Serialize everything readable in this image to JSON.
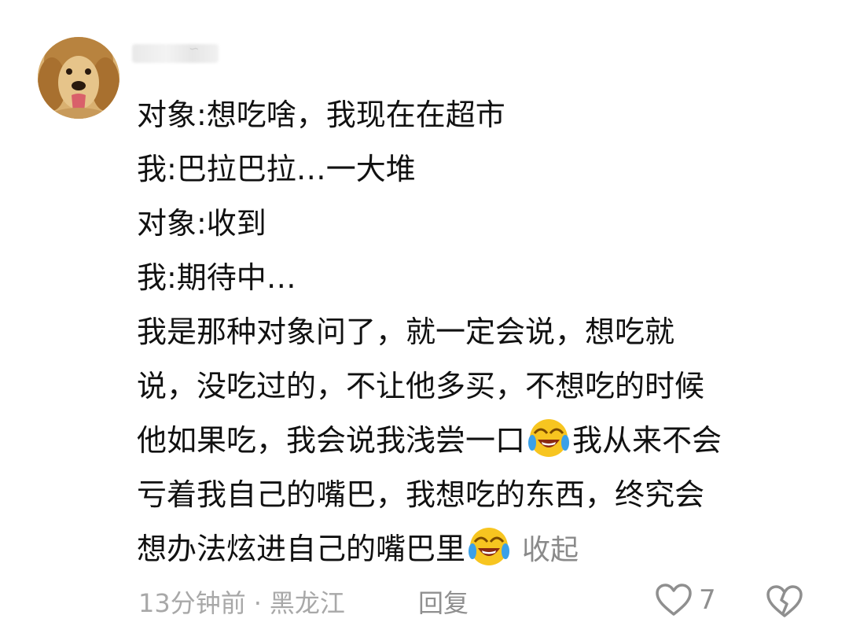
{
  "comment": {
    "author_avatar": "golden-retriever-avatar",
    "lines": [
      "对象:想吃啥，我现在在超市",
      "我:巴拉巴拉…一大堆",
      "对象:收到",
      "我:期待中…",
      "我是那种对象问了，就一定会说，想吃就",
      "说，没吃过的，不让他多买，不想吃的时候",
      "他如果吃，我会说我浅尝一口",
      "我从来不会",
      "亏着我自己的嘴巴，我想吃的东西，终究会",
      "想办法炫进自己的嘴巴里"
    ],
    "emoji_name": "laughing-crying-emoji",
    "collapse_label": "收起"
  },
  "meta": {
    "time": "13分钟前",
    "separator": "·",
    "location": "黑龙江",
    "reply_label": "回复",
    "like_count": "7"
  },
  "colors": {
    "text": "#111111",
    "muted": "#a8a8a8",
    "action": "#8f8f8f"
  }
}
